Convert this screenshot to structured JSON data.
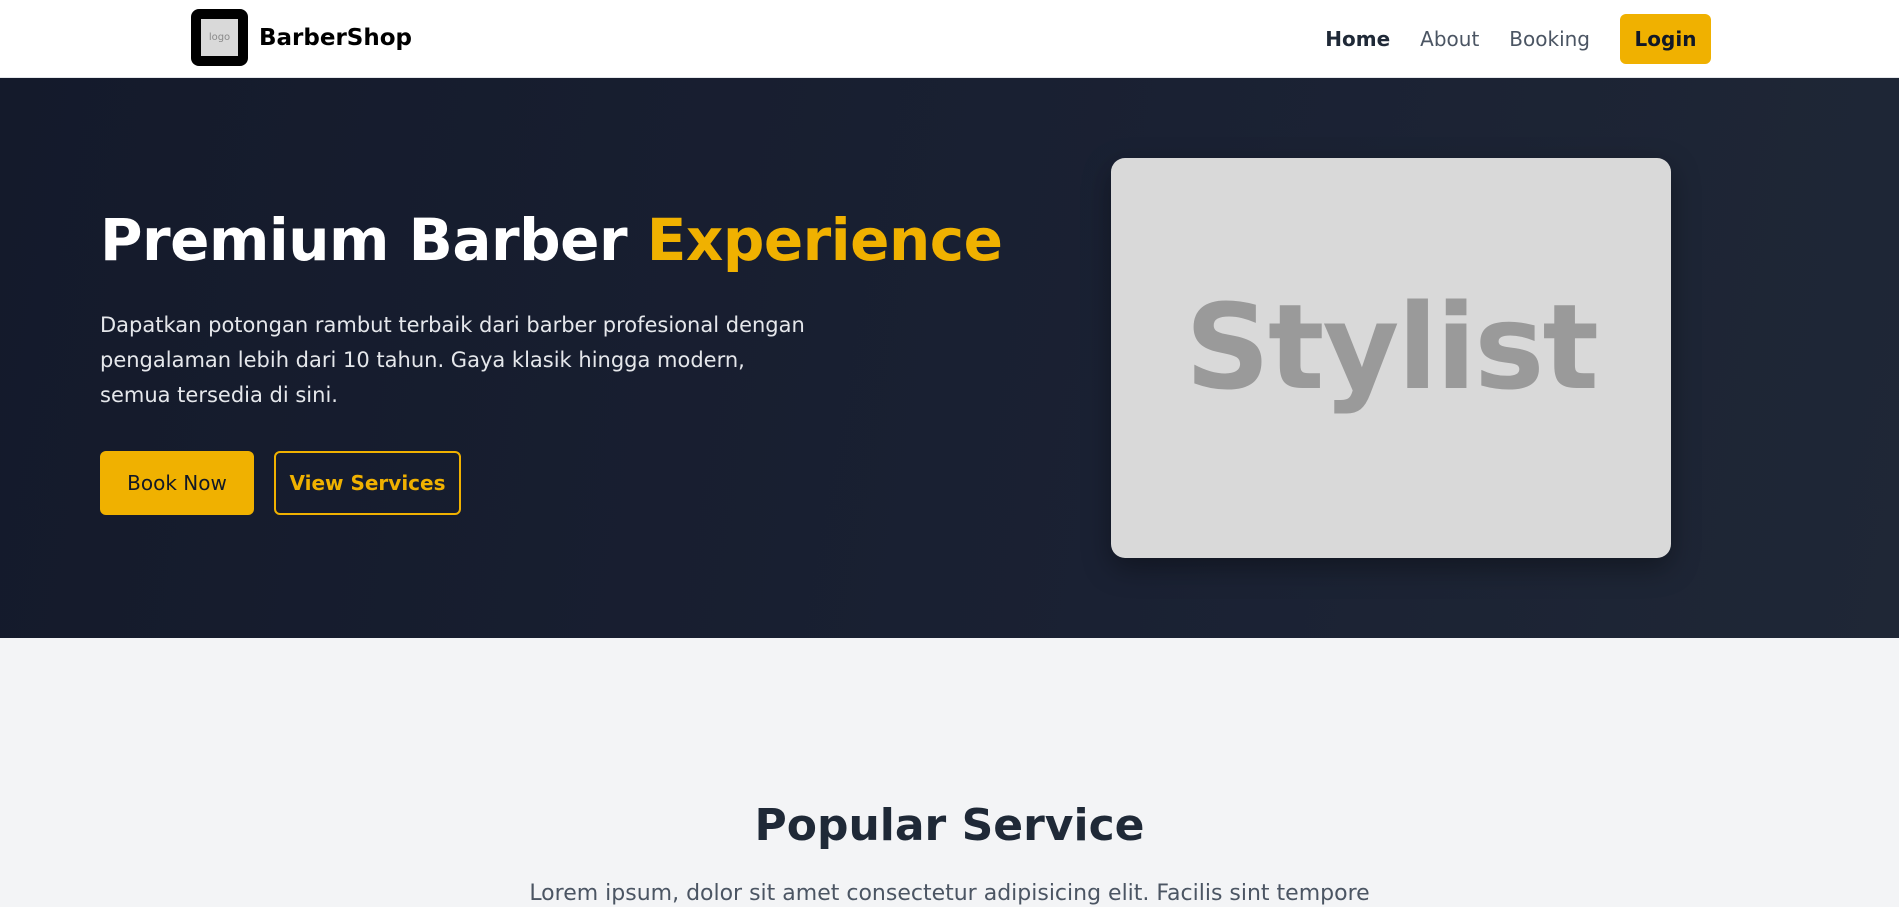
{
  "nav": {
    "logo_text": "logo",
    "brand": "BarberShop",
    "links": [
      "Home",
      "About",
      "Booking"
    ],
    "login_label": "Login"
  },
  "hero": {
    "title_main": "Premium Barber ",
    "title_accent": "Experience",
    "description": "Dapatkan potongan rambut terbaik dari barber profesional dengan pengalaman lebih dari 10 tahun. Gaya klasik hingga modern, semua tersedia di sini.",
    "book_label": "Book Now",
    "services_label": "View Services",
    "image_placeholder": "Stylist"
  },
  "services": {
    "title": "Popular Service",
    "description": "Lorem ipsum, dolor sit amet consectetur adipisicing elit. Facilis sint tempore"
  },
  "colors": {
    "accent": "#f0b100",
    "hero_bg": "#141a2b",
    "section_bg": "#f3f4f6"
  }
}
